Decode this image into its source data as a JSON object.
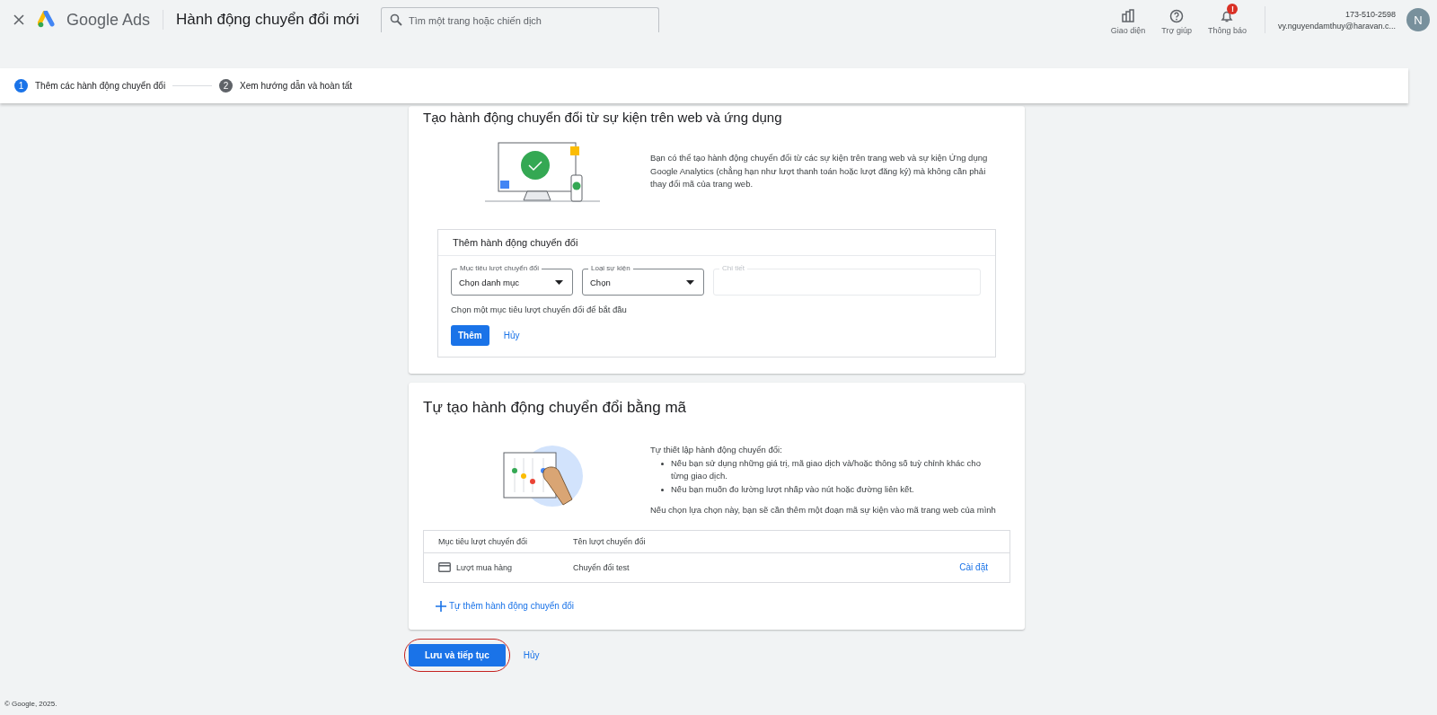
{
  "header": {
    "product": "Google Ads",
    "title": "Hành động chuyển đổi mới",
    "search": {
      "placeholder": "Tìm một trang hoặc chiến dịch"
    },
    "tools": [
      {
        "kind": "appearance",
        "label": "Giao diện"
      },
      {
        "kind": "help",
        "label": "Trợ giúp"
      },
      {
        "kind": "bell",
        "label": "Thông báo",
        "badge": "!"
      }
    ],
    "account": {
      "id": "173-510-2598",
      "email": "vy.nguyendamthuy@haravan.c...",
      "avatar": "N"
    }
  },
  "steps": [
    {
      "number": "1",
      "label": "Thêm các hành động chuyển đổi",
      "selected": true
    },
    {
      "number": "2",
      "label": "Xem hướng dẫn và hoàn tất",
      "selected": false
    }
  ],
  "web_card": {
    "title": "Tạo hành động chuyển đổi từ sự kiện trên web và ứng dụng",
    "description": "Bạn có thể tạo hành động chuyển đổi từ các sự kiện trên trang web và sự kiện Ứng dụng Google Analytics (chẳng hạn như lượt thanh toán hoặc lượt đăng ký) mà không cần phải thay đổi mã của trang web.",
    "form": {
      "title": "Thêm hành động chuyển đổi",
      "fields": [
        {
          "label": "Mục tiêu lượt chuyển đổi",
          "value": "Chọn danh mục",
          "disabled": false
        },
        {
          "label": "Loại sự kiện",
          "value": "Chọn",
          "disabled": false
        },
        {
          "label": "Chi tiết",
          "disabled": true
        }
      ],
      "hint": "Chọn một mục tiêu lượt chuyển đổi để bắt đầu",
      "add_button": "Thêm",
      "cancel": "Hủy"
    }
  },
  "code_card": {
    "title": "Tự tạo hành động chuyển đổi bằng mã",
    "intro": "Tự thiết lập hành động chuyển đổi:",
    "bullets": [
      "Nếu bạn sử dụng những giá trị, mã giao dịch và/hoặc thông số tuỳ chỉnh khác cho từng giao dịch.",
      "Nếu bạn muốn đo lường lượt nhấp vào nút hoặc đường liên kết."
    ],
    "note": "Nếu chọn lựa chọn này, bạn sẽ cần thêm một đoạn mã sự kiện vào mã trang web của mình",
    "table": {
      "columns": [
        "Mục tiêu lượt chuyển đổi",
        "Tên lượt chuyển đổi"
      ],
      "rows": [
        {
          "goal": "Lượt mua hàng",
          "name": "Chuyển đổi test",
          "action": "Cài đặt"
        }
      ]
    },
    "add_link": "Tự thêm hành động chuyển đổi"
  },
  "actions": {
    "save": "Lưu và tiếp tục",
    "save_highlighted": true,
    "cancel": "Hủy"
  },
  "footer": "© Google, 2025."
}
